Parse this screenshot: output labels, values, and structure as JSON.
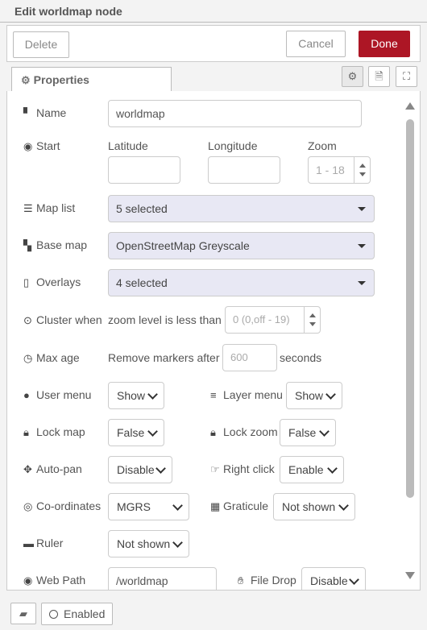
{
  "header": {
    "title": "Edit worldmap node"
  },
  "toolbar": {
    "delete_label": "Delete",
    "cancel_label": "Cancel",
    "done_label": "Done"
  },
  "tabs": {
    "properties_label": "Properties"
  },
  "form": {
    "name": {
      "label": "Name",
      "value": "worldmap"
    },
    "start": {
      "label": "Start",
      "latitude_label": "Latitude",
      "longitude_label": "Longitude",
      "zoom_label": "Zoom",
      "latitude_value": "",
      "longitude_value": "",
      "zoom_placeholder": "1 - 18"
    },
    "map_list": {
      "label": "Map list",
      "value": "5 selected"
    },
    "base_map": {
      "label": "Base map",
      "value": "OpenStreetMap Greyscale"
    },
    "overlays": {
      "label": "Overlays",
      "value": "4 selected"
    },
    "cluster": {
      "label": "Cluster when",
      "text": "zoom level is less than",
      "placeholder": "0 (0,off - 19)"
    },
    "max_age": {
      "label": "Max age",
      "text_before": "Remove markers after",
      "placeholder": "600",
      "text_after": "seconds"
    },
    "user_menu": {
      "label": "User menu",
      "value": "Show"
    },
    "layer_menu": {
      "label": "Layer menu",
      "value": "Show"
    },
    "lock_map": {
      "label": "Lock map",
      "value": "False"
    },
    "lock_zoom": {
      "label": "Lock zoom",
      "value": "False"
    },
    "auto_pan": {
      "label": "Auto-pan",
      "value": "Disable"
    },
    "right_click": {
      "label": "Right click",
      "value": "Enable"
    },
    "coordinates": {
      "label": "Co-ordinates",
      "value": "MGRS"
    },
    "graticule": {
      "label": "Graticule",
      "value": "Not shown"
    },
    "ruler": {
      "label": "Ruler",
      "value": "Not shown"
    },
    "web_path": {
      "label": "Web Path",
      "value": "/worldmap"
    },
    "file_drop": {
      "label": "File Drop",
      "value": "Disable"
    }
  },
  "footer": {
    "enabled_label": "Enabled"
  },
  "colors": {
    "done": "#ad1625",
    "multiselect_bg": "#e8e8f4"
  }
}
